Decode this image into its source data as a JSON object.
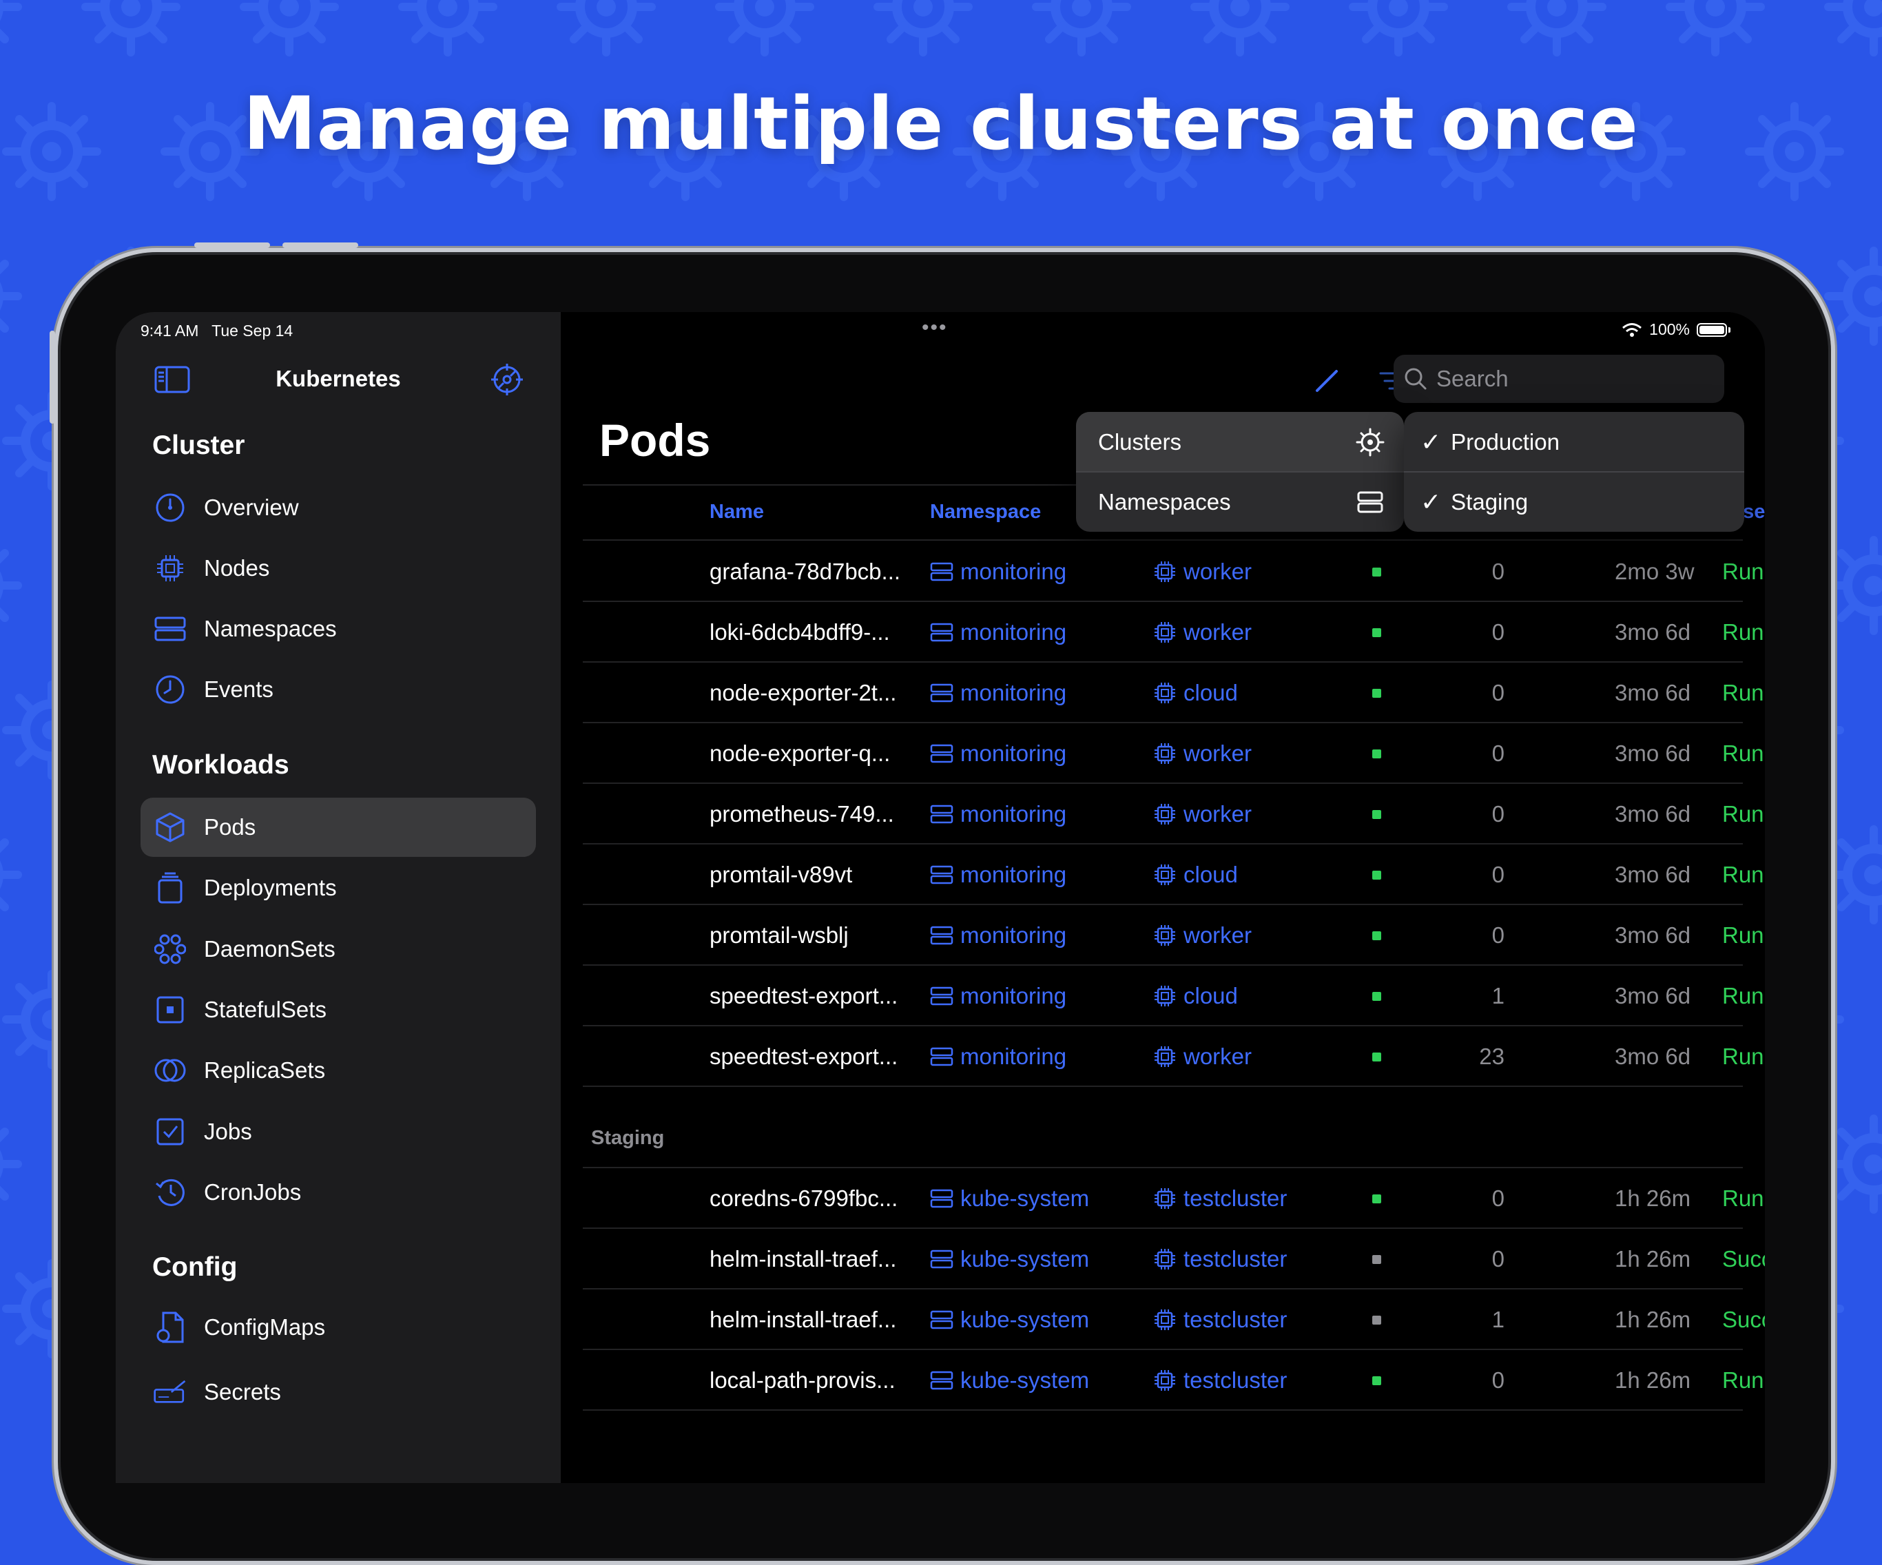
{
  "headline": "Manage multiple clusters at once",
  "status_bar": {
    "time": "9:41 AM   Tue Sep 14",
    "multitask": "•••",
    "battery": "100%"
  },
  "sidebar": {
    "title": "Kubernetes",
    "sections": [
      {
        "title": "Cluster",
        "items": [
          "Overview",
          "Nodes",
          "Namespaces",
          "Events"
        ]
      },
      {
        "title": "Workloads",
        "items": [
          "Pods",
          "Deployments",
          "DaemonSets",
          "StatefulSets",
          "ReplicaSets",
          "Jobs",
          "CronJobs"
        ]
      },
      {
        "title": "Config",
        "items": [
          "ConfigMaps",
          "Secrets"
        ]
      }
    ],
    "selected": "Pods"
  },
  "toolbar": {
    "search_placeholder": "Search"
  },
  "page": {
    "title": "Pods"
  },
  "table": {
    "columns": {
      "name": "Name",
      "namespace": "Namespace",
      "phase_partial": "ase"
    },
    "groups": [
      {
        "label": "",
        "rows": [
          {
            "name": "grafana-78d7bcb...",
            "namespace": "monitoring",
            "node": "worker",
            "ready": true,
            "restarts": "0",
            "age": "2mo 3w",
            "phase": "Running"
          },
          {
            "name": "loki-6dcb4bdff9-...",
            "namespace": "monitoring",
            "node": "worker",
            "ready": true,
            "restarts": "0",
            "age": "3mo 6d",
            "phase": "Running"
          },
          {
            "name": "node-exporter-2t...",
            "namespace": "monitoring",
            "node": "cloud",
            "ready": true,
            "restarts": "0",
            "age": "3mo 6d",
            "phase": "Running"
          },
          {
            "name": "node-exporter-q...",
            "namespace": "monitoring",
            "node": "worker",
            "ready": true,
            "restarts": "0",
            "age": "3mo 6d",
            "phase": "Running"
          },
          {
            "name": "prometheus-749...",
            "namespace": "monitoring",
            "node": "worker",
            "ready": true,
            "restarts": "0",
            "age": "3mo 6d",
            "phase": "Running"
          },
          {
            "name": "promtail-v89vt",
            "namespace": "monitoring",
            "node": "cloud",
            "ready": true,
            "restarts": "0",
            "age": "3mo 6d",
            "phase": "Running"
          },
          {
            "name": "promtail-wsblj",
            "namespace": "monitoring",
            "node": "worker",
            "ready": true,
            "restarts": "0",
            "age": "3mo 6d",
            "phase": "Running"
          },
          {
            "name": "speedtest-export...",
            "namespace": "monitoring",
            "node": "cloud",
            "ready": true,
            "restarts": "1",
            "age": "3mo 6d",
            "phase": "Running"
          },
          {
            "name": "speedtest-export...",
            "namespace": "monitoring",
            "node": "worker",
            "ready": true,
            "restarts": "23",
            "age": "3mo 6d",
            "phase": "Running"
          }
        ]
      },
      {
        "label": "Staging",
        "rows": [
          {
            "name": "coredns-6799fbc...",
            "namespace": "kube-system",
            "node": "testcluster",
            "ready": true,
            "restarts": "0",
            "age": "1h 26m",
            "phase": "Running"
          },
          {
            "name": "helm-install-traef...",
            "namespace": "kube-system",
            "node": "testcluster",
            "ready": false,
            "restarts": "0",
            "age": "1h 26m",
            "phase": "Succeeded"
          },
          {
            "name": "helm-install-traef...",
            "namespace": "kube-system",
            "node": "testcluster",
            "ready": false,
            "restarts": "1",
            "age": "1h 26m",
            "phase": "Succeeded"
          },
          {
            "name": "local-path-provis...",
            "namespace": "kube-system",
            "node": "testcluster",
            "ready": true,
            "restarts": "0",
            "age": "1h 26m",
            "phase": "Running"
          }
        ]
      }
    ]
  },
  "menu": {
    "items": [
      {
        "label": "Clusters",
        "icon": "helm-wheel-icon"
      },
      {
        "label": "Namespaces",
        "icon": "namespace-icon"
      }
    ],
    "submenu": [
      {
        "label": "Production",
        "checked": true,
        "check": "✓"
      },
      {
        "label": "Staging",
        "checked": true,
        "check": "✓"
      }
    ]
  },
  "colors": {
    "accent": "#3f6cff",
    "running": "#30d158",
    "ready_dot": "#30d158",
    "not_ready_dot": "#8e8e93",
    "background": "#2a55e8"
  }
}
